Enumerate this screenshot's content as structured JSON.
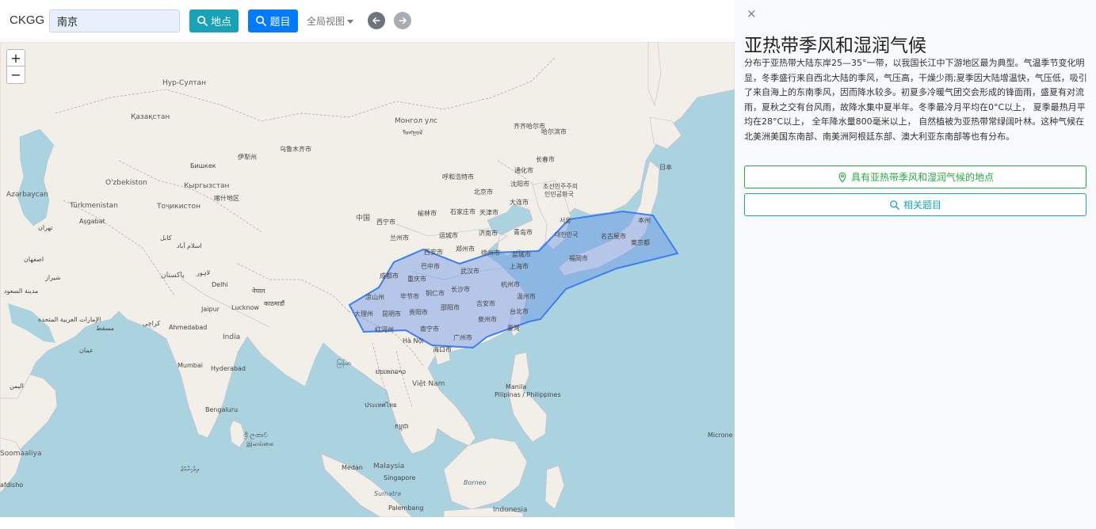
{
  "toolbar": {
    "brand": "CKGG",
    "search_value": "南京",
    "place_button": "地点",
    "question_button": "题目",
    "view_dropdown": "全局视图"
  },
  "map": {
    "zoom_in": "+",
    "zoom_out": "−",
    "attribution_right": "Microne",
    "labels": {
      "nur_sultan": "Нур-Султан",
      "kazakhstan": "Қазақстан",
      "mongolia": "Монгол улс",
      "mongolia_trad": "ᠮᠣᠩᠭᠣᠯ",
      "qiqihar": "齐齐哈尔市",
      "harbin": "哈尔滨市",
      "changchun": "长春市",
      "urumqi": "乌鲁木齐市",
      "yili": "伊犁州",
      "bishkek": "Бишкек",
      "kyrgyzstan": "Кыргызстан",
      "ozbekiston": "O'zbekiston",
      "kashi": "喀什地区",
      "tojikiston": "Тоҷикистон",
      "azerbaycan": "Azərbaycan",
      "turkmenistan": "Türkmenistan",
      "asgabat": "Aşgabat",
      "tehran": "تهران",
      "kabul": "کابل",
      "islamabad": "اسلام آباد",
      "pakistan": "پاکستان",
      "esfahan": "اصفهان",
      "shiraz": "شیراز",
      "lahore": "لاہور",
      "delhi": "Delhi",
      "lucknow": "Lucknow",
      "jaipur": "Jaipur",
      "nepal": "नेपाल",
      "kathmandu": "काठमाडौं",
      "india": "India",
      "ahmedabad": "Ahmedabad",
      "karachi": "کراچی",
      "uae": "الإمارات العربية المتحدة",
      "oman": "عمان",
      "muscat": "مسقط",
      "madinah": "مدينة السعود",
      "mumbai": "Mumbai",
      "hyderabad": "Hyderabad",
      "bengaluru": "Bengaluru",
      "srilanka": "ශ්‍රී ලංකාව",
      "srilanka2": "இலங்கை",
      "maldives": "ދިވެހިރާއްޖެ",
      "somalia": "Soomaaliya",
      "yemen": "اليمن",
      "afdisho": "afdisho",
      "china": "中国",
      "xining": "西宁市",
      "lanzhou": "兰州市",
      "yinchuan": "榆林市",
      "shijiazhuang": "石家庄市",
      "beijing": "北京市",
      "tianjin": "天津市",
      "huhehaote": "呼和浩特市",
      "shenyang": "沈阳市",
      "tonghua": "通化市",
      "dalian": "大连市",
      "jinan": "济南市",
      "qingdao": "青岛市",
      "yuncheng": "运城市",
      "zhengzhou": "郑州市",
      "xian": "西安市",
      "xuzhou": "徐州市",
      "yancheng": "盐城市",
      "chengdu": "成都市",
      "bazhong": "巴中市",
      "chongqing": "重庆市",
      "wuhan": "武汉市",
      "shanghai": "上海市",
      "hangzhou": "杭州市",
      "changsha": "长沙市",
      "tongren": "铜仁市",
      "liangshan": "凉山州",
      "bijie": "毕节市",
      "wenzhou": "温州市",
      "guiyang": "贵阳市",
      "shaoyang": "邵阳市",
      "jian": "吉安市",
      "dali": "大理州",
      "kunming": "昆明市",
      "quanzhou": "泉州市",
      "taibei": "台北市",
      "honghe": "红河州",
      "nanning": "南宁市",
      "guangzhou": "广州市",
      "taiwan": "臺灣",
      "hanoi": "Hà Nội",
      "haikou": "海口市",
      "myanmar": "မြန်မာ",
      "laos": "ປະເທດລາວ",
      "thailand": "ประเทศไทย",
      "vietnam": "Việt Nam",
      "cambodia": "កម្ពុជា",
      "manila": "Manila",
      "philippines": "Pilipinas / Philippines",
      "malaysia": "Malaysia",
      "singapore": "Singapore",
      "medan": "Medan",
      "borneo": "Borneo",
      "sumatra": "Sumatra",
      "palembang": "Palembang",
      "indonesia": "Indonesia",
      "japan": "日本",
      "joseon": "조선민주주의",
      "joseon2": "인민공화국",
      "seoul": "서울",
      "korea": "대한민국",
      "honshu": "本州",
      "nagoya": "名古屋市",
      "tokyo": "東京都",
      "fukuoka": "福岡市"
    }
  },
  "panel": {
    "close": "×",
    "title": "亚热带季风和湿润气候",
    "description": "分布于亚热带大陆东岸25—35°一带，以我国长江中下游地区最为典型。气温季节变化明显，冬季盛行来自西北大陆的季风，气压高，干燥少雨;夏季因大陆增温快，气压低，吸引了来自海上的东南季风，因而降水较多。初夏多冷暖气团交会形成的锋面雨，盛夏有对流雨，夏秋之交有台风雨，故降水集中夏半年。冬季最冷月平均在0°C以上， 夏季最热月平均在28°C以上， 全年降水量800毫米以上， 自然植被为亚热带常绿阔叶林。这种气候在北美洲美国东南部、南美洲阿根廷东部、澳大利亚东南部等也有分布。",
    "places_button": "具有亚热带季风和湿润气候的地点",
    "related_button": "相关题目"
  },
  "colors": {
    "place_button": "#17a2b8",
    "question_button": "#007bff",
    "places_outline": "#28a745",
    "related_outline": "#17a2b8",
    "region_stroke": "#3d7ff0",
    "region_fill": "#6a95e8",
    "sea": "#aad3df",
    "land": "#f2efe9"
  },
  "icons": {
    "search": "search-icon",
    "marker": "map-marker-icon",
    "back": "arrow-left-icon",
    "forward": "arrow-right-icon",
    "close": "close-icon"
  }
}
